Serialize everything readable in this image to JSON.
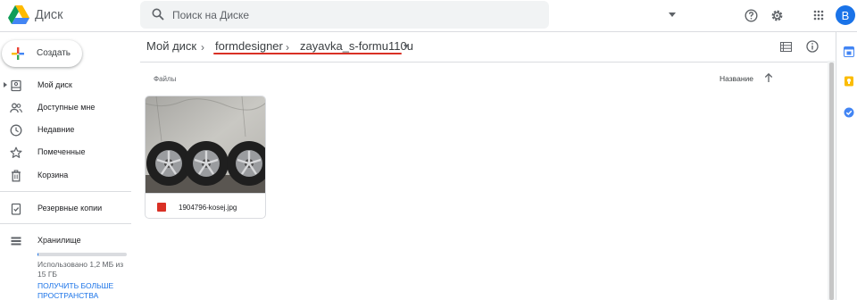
{
  "header": {
    "app_title": "Диск",
    "search_placeholder": "Поиск на Диске",
    "avatar_initial": "B"
  },
  "sidebar": {
    "new_button": "Создать",
    "items": [
      {
        "label": "Мой диск",
        "icon": "my-drive-icon"
      },
      {
        "label": "Доступные мне",
        "icon": "shared-with-me-icon"
      },
      {
        "label": "Недавние",
        "icon": "recent-icon"
      },
      {
        "label": "Помеченные",
        "icon": "starred-icon"
      },
      {
        "label": "Корзина",
        "icon": "trash-icon"
      },
      {
        "label": "Резервные копии",
        "icon": "backups-icon"
      },
      {
        "label": "Хранилище",
        "icon": "storage-icon"
      }
    ],
    "storage": {
      "used_text": "Использовано 1,2 МБ из 15 ГБ",
      "used_fraction": 0.0001,
      "buy_link": "ПОЛУЧИТЬ БОЛЬШЕ ПРОСТРАНСТВА"
    }
  },
  "breadcrumb": {
    "root": "Мой диск",
    "folder": "formdesigner",
    "current": "zayavka_s-formu110u"
  },
  "main": {
    "section_label": "Файлы",
    "sort_label": "Название",
    "files": [
      {
        "name": "1904796-kosej.jpg",
        "type": "image"
      }
    ]
  },
  "colors": {
    "accent": "#1a73e8",
    "highlight": "#d93025"
  }
}
